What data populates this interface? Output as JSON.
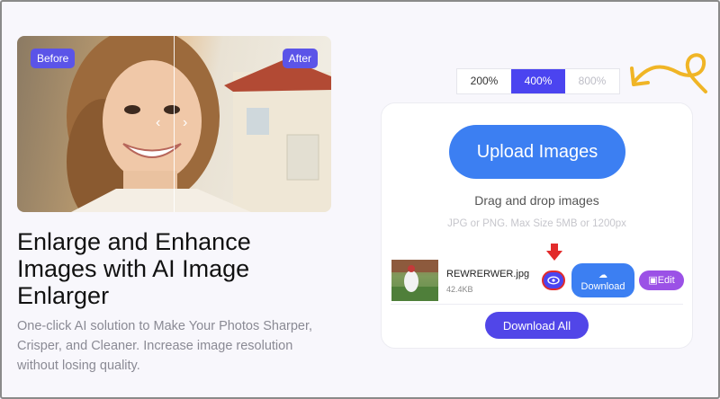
{
  "hero": {
    "before_label": "Before",
    "after_label": "After"
  },
  "content": {
    "heading": "Enlarge and Enhance Images with AI Image Enlarger",
    "subheading": "One-click AI solution to Make Your Photos Sharper, Crisper, and Cleaner. Increase image resolution without losing quality."
  },
  "scales": {
    "options": [
      "200%",
      "400%",
      "800%"
    ],
    "selected": "400%",
    "disabled": "800%"
  },
  "upload": {
    "button_label": "Upload Images",
    "drag_text": "Drag and drop images",
    "limits_text": "JPG or PNG. Max Size 5MB or 1200px"
  },
  "file": {
    "name": "REWRERWER.jpg",
    "size": "42.4KB",
    "download_label": "Download",
    "edit_label": "Edit"
  },
  "download_all_label": "Download All",
  "colors": {
    "accent": "#4b44f0",
    "upload_blue": "#3c7ff2",
    "edit_purple": "#9b51e6",
    "highlight_red": "#e22b2b",
    "doodle_yellow": "#f0b526"
  },
  "icons": [
    "chevron-left-icon",
    "chevron-right-icon",
    "eye-icon",
    "cloud-download-icon",
    "edit-icon",
    "red-down-arrow-icon",
    "curly-arrow-icon"
  ]
}
